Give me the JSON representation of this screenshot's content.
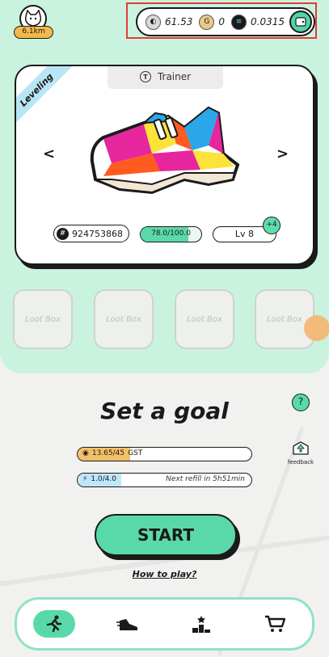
{
  "profile": {
    "distance": "6.1km"
  },
  "balances": {
    "gmt": "61.53",
    "gst": "0",
    "sol": "0.0315"
  },
  "card": {
    "tab_label": "Trainer",
    "ribbon": "Leveling",
    "sneaker_id": "924753868",
    "level_progress_text": "78.0/100.0",
    "level_progress": 0.78,
    "level_label": "Lv 8",
    "plus_badge": "+4"
  },
  "loot_boxes": [
    {
      "label": "Loot Box"
    },
    {
      "label": "Loot Box"
    },
    {
      "label": "Loot Box"
    },
    {
      "label": "Loot Box"
    }
  ],
  "goal": {
    "title": "Set a goal",
    "gst_text": "13.65/45",
    "gst_unit": "GST",
    "gst_progress": 0.3033,
    "energy_text": "1.0/4.0",
    "energy_progress": 0.25,
    "refill_text": "Next refill in 5h51min"
  },
  "start_label": "START",
  "how_to_play": "How to play?",
  "feedback_label": "feedback",
  "help_label": "?",
  "nav": [
    {
      "name": "run",
      "icon": "running-icon"
    },
    {
      "name": "sneakers",
      "icon": "sneaker-icon"
    },
    {
      "name": "ranking",
      "icon": "podium-icon"
    },
    {
      "name": "marketplace",
      "icon": "cart-icon"
    }
  ],
  "colors": {
    "mint": "#c9f3de",
    "accent": "#59d9a9",
    "gst": "#f3c069",
    "energy": "#bfe6fb"
  }
}
